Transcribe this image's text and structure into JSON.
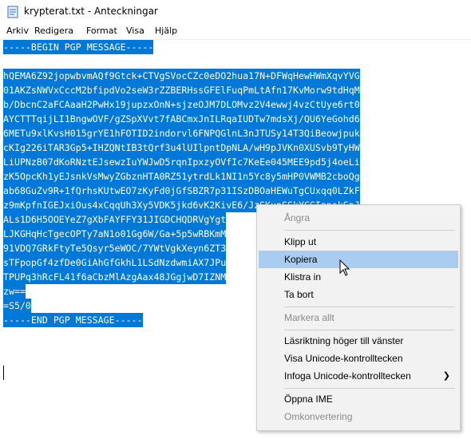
{
  "window": {
    "title": "krypterat.txt - Anteckningar"
  },
  "menu": [
    "Arkiv",
    "Redigera",
    "Format",
    "Visa",
    "Hjälp"
  ],
  "editor": {
    "lines": [
      "-----BEGIN PGP MESSAGE-----",
      "",
      "hQEMA6Z92jopwbvmAQf9Gtck+CTVgSVocCZc0eDO2hua17N+DFWqHewHWmXqvYVG",
      "01AKZsNWVxCccM2bfipdVo2seW3rZZBERHssGFElFuqPmLtAfn17KvMorw9tdHqM",
      "b/DbcnC2aFCAaaH2PwHx19jupzxOnN+sjzeOJM7DLOMvz2V4ewwj4vzCtUye6rt0",
      "AYCTTTqijLI1BngwOVF/gZSpXVvt7fABCmxJnILRqaIUDTw7mdsXj/QU6YeGohd6",
      "6METu9xlKvsH015grYE1hFOTID2indorvl6FNPQGlnL3nJTUSy14T3QiBeowjpuk",
      "cKIg226iTAR3Gp5+IHZQNtIB3tQrf3u4lUIlpntDpNLA/wH9pJVKn0XUSvb9TyHW",
      "LiUPNzB07dKoRNztEJsewzIuYWJwD5rqnIpxzyOVfIc7KeEe045MEE9pd5j4oeLi",
      "zK5OpcKh1yEJsnkVsMwyZGbznHTA0RZ51ytrdLk1NI1n5Yc8y5mHP0VWMB2cboQg",
      "ab68GuZv9R+1fQrhsKUtwEO7zKyFd0jGfSBZR7p31ISzDBOaHEWuTgCUxqq0LZkF",
      "z9mKpfnIGEJxiOus4xCqqUh3Xy5VDK5jkd6vK2KivE6/JzSKunSSkYCGInpskSpJ",
      "ALs1D6H5OOEYeZ7gXbFAYFFY31JIGDCHQDRVgYgt",
      "LJKGHqHcTgecOPTy7aN1o01Gg6W/Ga+5p5wRBKmM",
      "91VDQ7GRkFtyTe5Qsyr5eWOC/7YWtVgkXeyn6ZT3",
      "sTFpopGf4zfDe0GiAhGfGkhL1LSdNzdwmiAX7JPu",
      "TPUPq3hRcFL41f6aCbzMlAzgAax48JGgjwD7IZNM",
      "zw==",
      "=S5/0",
      "-----END PGP MESSAGE-----"
    ]
  },
  "context_menu": {
    "items": [
      {
        "label": "Ångra",
        "disabled": true
      },
      {
        "separator": true
      },
      {
        "label": "Klipp ut"
      },
      {
        "label": "Kopiera",
        "hover": true
      },
      {
        "label": "Klistra in"
      },
      {
        "label": "Ta bort"
      },
      {
        "separator": true
      },
      {
        "label": "Markera allt",
        "disabled": true
      },
      {
        "separator": true
      },
      {
        "label": "Läsriktning höger till vänster"
      },
      {
        "label": "Visa Unicode-kontrolltecken"
      },
      {
        "label": "Infoga Unicode-kontrolltecken",
        "submenu": true
      },
      {
        "separator": true
      },
      {
        "label": "Öppna IME"
      },
      {
        "label": "Omkonvertering",
        "disabled": true
      }
    ]
  },
  "colors": {
    "selection": "#0078d7",
    "hover": "#a8cdf0",
    "menu_bg": "#f2f2f2"
  },
  "icons": {
    "app": "notepad-icon",
    "submenu": "chevron-right-icon",
    "cursor": "mouse-pointer-icon"
  }
}
